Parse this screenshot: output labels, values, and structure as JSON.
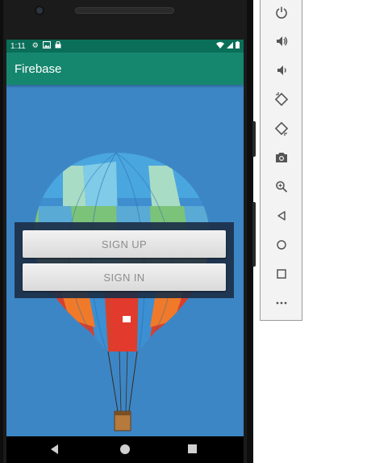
{
  "status_bar": {
    "time": "1:11",
    "icons": [
      "settings-icon",
      "photo-icon",
      "lock-icon",
      "wifi-icon",
      "signal-icon",
      "battery-icon"
    ]
  },
  "app_bar": {
    "title": "Firebase"
  },
  "auth_panel": {
    "sign_up_label": "SIGN UP",
    "sign_in_label": "SIGN IN"
  },
  "nav_bar": {
    "buttons": [
      "back-icon",
      "home-icon",
      "recents-icon"
    ]
  },
  "emulator_toolbar": {
    "tools": [
      "power-icon",
      "volume-up-icon",
      "volume-down-icon",
      "rotate-left-icon",
      "rotate-right-icon",
      "camera-icon",
      "zoom-icon",
      "back-icon",
      "home-icon",
      "overview-icon",
      "more-icon"
    ]
  },
  "colors": {
    "status_bar": "#0b6e59",
    "app_bar": "#16876f",
    "sky": "#3d86c6",
    "panel": "#1c3048",
    "button_text": "#8d8d8d",
    "toolbar_icon": "#555555"
  }
}
